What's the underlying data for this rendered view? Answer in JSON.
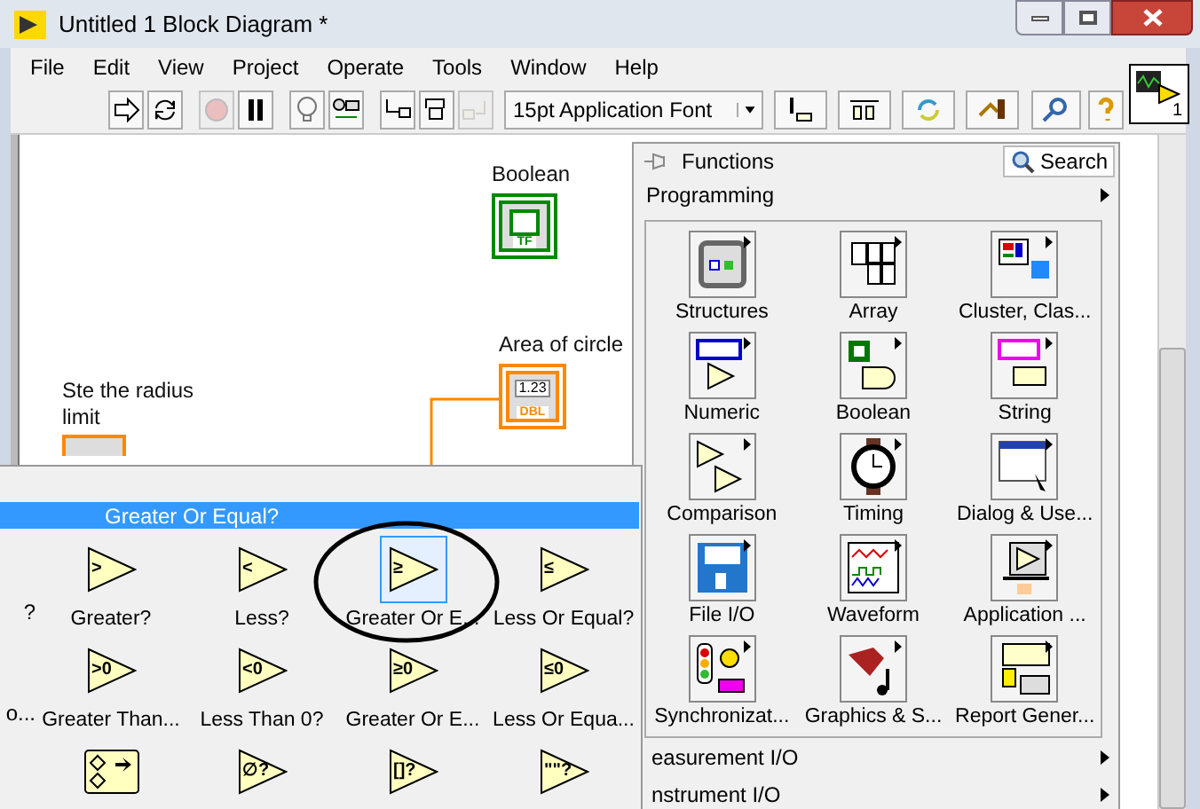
{
  "window": {
    "title": "Untitled 1 Block Diagram *"
  },
  "menu": [
    "File",
    "Edit",
    "View",
    "Project",
    "Operate",
    "Tools",
    "Window",
    "Help"
  ],
  "toolbar": {
    "buttons": [
      {
        "kind": "run",
        "disabled": false
      },
      {
        "kind": "run-continuous",
        "disabled": false
      },
      {
        "kind": "abort",
        "disabled": true
      },
      {
        "kind": "pause",
        "disabled": false
      },
      {
        "kind": "highlight",
        "disabled": false
      },
      {
        "kind": "retain",
        "disabled": false
      },
      {
        "kind": "step-into",
        "disabled": false
      },
      {
        "kind": "step-over",
        "disabled": false
      },
      {
        "kind": "step-out",
        "disabled": true
      }
    ],
    "font": "15pt Application Font",
    "tools": [
      {
        "kind": "align"
      },
      {
        "kind": "distribute"
      },
      {
        "kind": "reorder"
      },
      {
        "kind": "cleanup"
      }
    ],
    "right_tools": [
      {
        "kind": "search"
      },
      {
        "kind": "help"
      }
    ]
  },
  "connector_pane": {
    "number": "1"
  },
  "diagram": {
    "nodes": [
      {
        "kind": "boolean",
        "label": "Boolean",
        "type_label": "TF"
      },
      {
        "kind": "numeric",
        "label": "Area of circle",
        "value": "1.23",
        "type_label": "DBL"
      },
      {
        "kind": "control",
        "label": "Ste the radius limit"
      }
    ]
  },
  "functions_palette": {
    "title": "Functions",
    "search": "Search",
    "category": "Programming",
    "items": [
      {
        "kind": "structures",
        "label": "Structures"
      },
      {
        "kind": "array",
        "label": "Array"
      },
      {
        "kind": "cluster",
        "label": "Cluster, Clas..."
      },
      {
        "kind": "numeric",
        "label": "Numeric"
      },
      {
        "kind": "boolean",
        "label": "Boolean"
      },
      {
        "kind": "string",
        "label": "String"
      },
      {
        "kind": "comparison",
        "label": "Comparison"
      },
      {
        "kind": "timing",
        "label": "Timing"
      },
      {
        "kind": "dialog",
        "label": "Dialog & Use..."
      },
      {
        "kind": "file",
        "label": "File I/O"
      },
      {
        "kind": "waveform",
        "label": "Waveform"
      },
      {
        "kind": "application",
        "label": "Application ..."
      },
      {
        "kind": "sync",
        "label": "Synchronizat..."
      },
      {
        "kind": "graphics",
        "label": "Graphics & S..."
      },
      {
        "kind": "report",
        "label": "Report Gener..."
      }
    ],
    "more": [
      "easurement I/O",
      "nstrument I/O"
    ]
  },
  "comparison_palette": {
    "title": "Greater Or Equal?",
    "rows": [
      [
        {
          "kind": "cut",
          "label": "?"
        },
        {
          "kind": "function",
          "symbol": ">",
          "label": "Greater?",
          "selected": false
        },
        {
          "kind": "function",
          "symbol": "<",
          "label": "Less?",
          "selected": false
        },
        {
          "kind": "function",
          "symbol": "≥",
          "label": "Greater Or E...",
          "selected": true
        },
        {
          "kind": "function",
          "symbol": "≤",
          "label": "Less Or Equal?",
          "selected": false
        }
      ],
      [
        {
          "kind": "cut",
          "label": "o..."
        },
        {
          "kind": "function",
          "symbol": ">0",
          "label": "Greater Than...",
          "selected": false
        },
        {
          "kind": "function",
          "symbol": "<0",
          "label": "Less Than 0?",
          "selected": false
        },
        {
          "kind": "function",
          "symbol": "≥0",
          "label": "Greater Or E...",
          "selected": false
        },
        {
          "kind": "function",
          "symbol": "≤0",
          "label": "Less Or Equa...",
          "selected": false
        }
      ],
      [
        {
          "kind": "empty"
        },
        {
          "kind": "select",
          "selected": false
        },
        {
          "kind": "function",
          "symbol": "∅?",
          "selected": false
        },
        {
          "kind": "function",
          "symbol": "[]?",
          "selected": false
        },
        {
          "kind": "function",
          "symbol": "\"\"?",
          "selected": false
        }
      ]
    ]
  }
}
